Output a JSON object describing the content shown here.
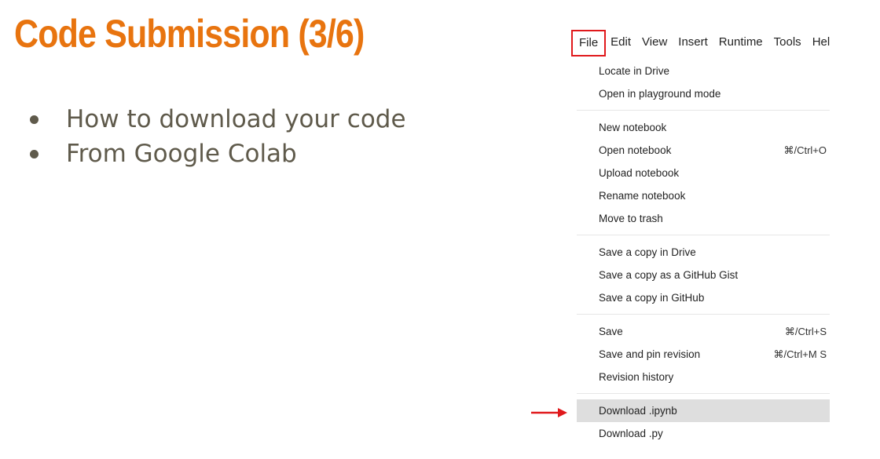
{
  "slide": {
    "title": "Code Submission (3/6)",
    "bullets": [
      "How to download your code",
      "From Google Colab"
    ]
  },
  "menubar": {
    "items": [
      "File",
      "Edit",
      "View",
      "Insert",
      "Runtime",
      "Tools",
      "Hel"
    ],
    "highlighted": "File",
    "highlight_color": "#e0191c"
  },
  "file_menu": {
    "groups": [
      [
        {
          "label": "Locate in Drive",
          "shortcut": ""
        },
        {
          "label": "Open in playground mode",
          "shortcut": ""
        }
      ],
      [
        {
          "label": "New notebook",
          "shortcut": ""
        },
        {
          "label": "Open notebook",
          "shortcut": "⌘/Ctrl+O"
        },
        {
          "label": "Upload notebook",
          "shortcut": ""
        },
        {
          "label": "Rename notebook",
          "shortcut": ""
        },
        {
          "label": "Move to trash",
          "shortcut": ""
        }
      ],
      [
        {
          "label": "Save a copy in Drive",
          "shortcut": ""
        },
        {
          "label": "Save a copy as a GitHub Gist",
          "shortcut": ""
        },
        {
          "label": "Save a copy in GitHub",
          "shortcut": ""
        }
      ],
      [
        {
          "label": "Save",
          "shortcut": "⌘/Ctrl+S"
        },
        {
          "label": "Save and pin revision",
          "shortcut": "⌘/Ctrl+M S"
        },
        {
          "label": "Revision history",
          "shortcut": ""
        }
      ],
      [
        {
          "label": "Download .ipynb",
          "shortcut": "",
          "highlighted": true
        },
        {
          "label": "Download .py",
          "shortcut": ""
        }
      ]
    ]
  },
  "colors": {
    "title": "#e8740f",
    "bullet_text": "#5f5a4b",
    "arrow": "#e0191c",
    "highlight_row": "#dedede"
  },
  "icons": {
    "pointer": "red-arrow-icon"
  }
}
